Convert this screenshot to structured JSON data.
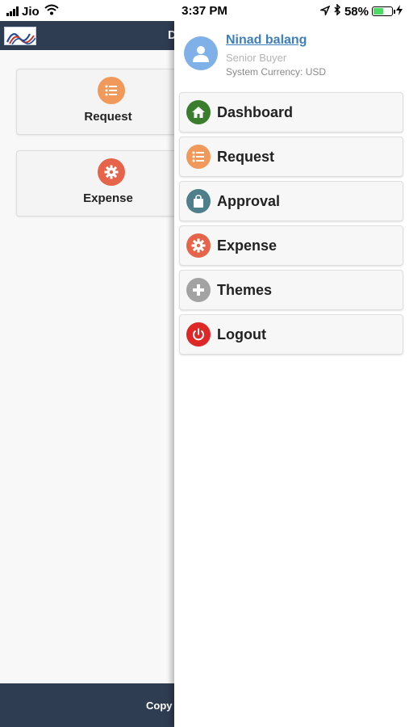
{
  "status_bar": {
    "carrier": "Jio",
    "time": "3:37 PM",
    "battery": "58%",
    "battery_level": 0.58
  },
  "background_app": {
    "header_partial_title": "D",
    "tiles": [
      {
        "label": "Request",
        "icon": "list-icon",
        "color": "#f0995a"
      },
      {
        "label": "Expense",
        "icon": "gear-icon",
        "color": "#e5644a"
      }
    ],
    "footer_partial_text": "Copy"
  },
  "drawer": {
    "user": {
      "name": "Ninad balang",
      "role": "Senior Buyer",
      "currency": "System Currency: USD"
    },
    "menu": [
      {
        "label": "Dashboard",
        "icon": "home-icon",
        "color": "#3a7d2c"
      },
      {
        "label": "Request",
        "icon": "list-icon",
        "color": "#f0995a"
      },
      {
        "label": "Approval",
        "icon": "bag-icon",
        "color": "#4e7f8a"
      },
      {
        "label": "Expense",
        "icon": "gear-icon",
        "color": "#e5644a"
      },
      {
        "label": "Themes",
        "icon": "plus-icon",
        "color": "#a3a3a3"
      },
      {
        "label": "Logout",
        "icon": "power-icon",
        "color": "#e02727"
      }
    ]
  }
}
